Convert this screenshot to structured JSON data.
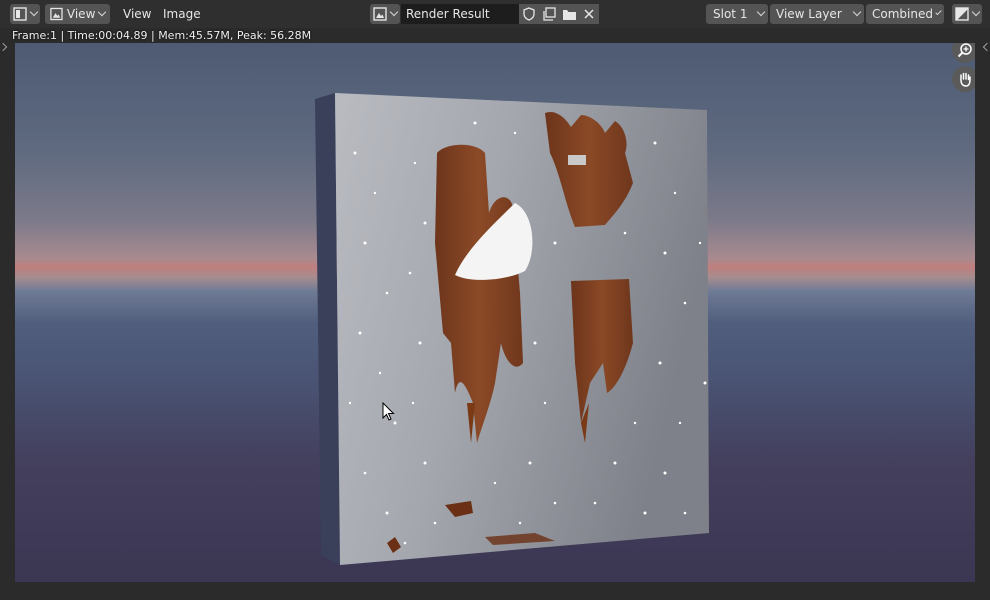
{
  "header": {
    "editor_type_icon": "image-editor-icon",
    "view_mode_label": "View",
    "menu": [
      {
        "label": "View"
      },
      {
        "label": "Image"
      }
    ],
    "image_name": "Render Result",
    "slot": "Slot 1",
    "view_layer": "View Layer",
    "pass": "Combined"
  },
  "info_text": "Frame:1 | Time:00:04.89 | Mem:45.57M, Peak: 56.28M",
  "viewport": {
    "tools": [
      {
        "icon": "zoom-in-icon"
      },
      {
        "icon": "hand-icon"
      }
    ]
  },
  "colors": {
    "header_bg": "#2f2f2f",
    "button_bg": "#545454",
    "field_bg": "#1d1d1d",
    "rust": "#7a3a16"
  }
}
